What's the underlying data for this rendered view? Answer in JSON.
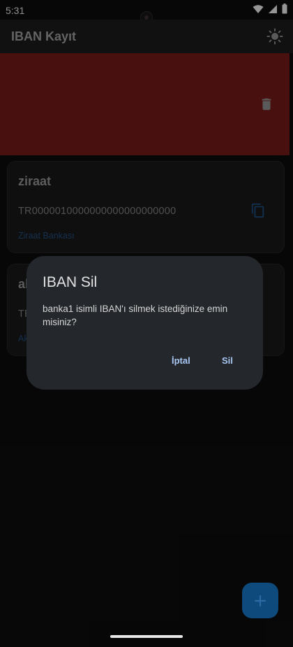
{
  "status_bar": {
    "time": "5:31"
  },
  "app_bar": {
    "title": "IBAN Kayıt",
    "theme_icon": "sun-icon"
  },
  "dismiss_action": {
    "icon": "trash-icon",
    "color": "#6f1b17"
  },
  "cards": [
    {
      "name": "ziraat",
      "iban": "TR0000010000000000000000000",
      "bank": "Ziraat Bankası"
    },
    {
      "name": "al",
      "iban": "TF",
      "bank": "Ak"
    }
  ],
  "dialog": {
    "title": "IBAN Sil",
    "message": "banka1 isimli IBAN'ı silmek istediğinize emin misiniz?",
    "cancel_label": "İptal",
    "delete_label": "Sil"
  },
  "fab": {
    "icon": "plus-icon",
    "color": "#0e4a7c"
  }
}
